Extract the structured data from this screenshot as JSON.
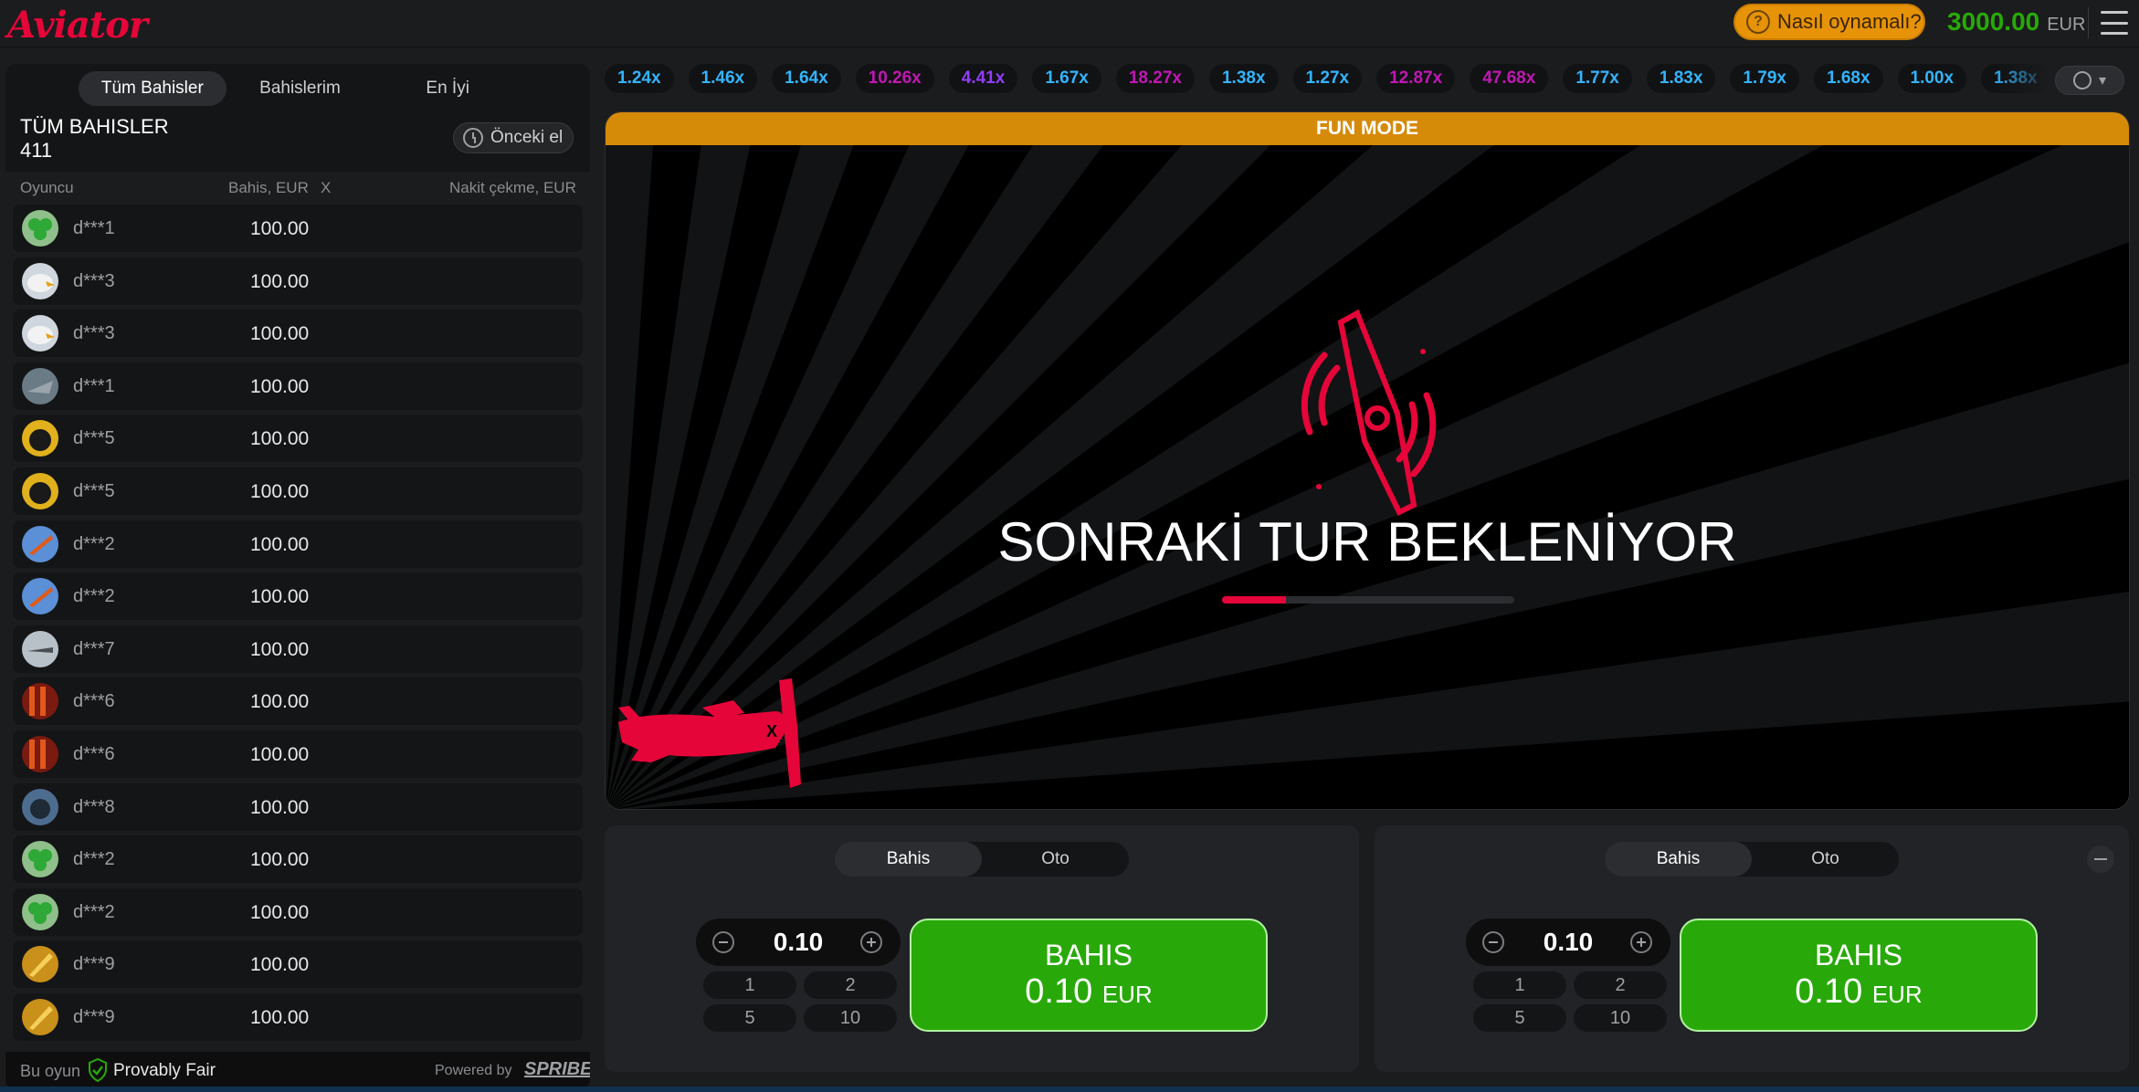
{
  "header": {
    "logo": "Aviator",
    "how_to_play": "Nasıl oynamalı?",
    "balance_amount": "3000.00",
    "balance_currency": "EUR"
  },
  "bets_panel": {
    "tabs": [
      "Tüm Bahisler",
      "Bahislerim",
      "En İyi"
    ],
    "active_tab": 0,
    "title": "TÜM BAHISLER",
    "count": "411",
    "previous_round": "Önceki el",
    "columns": {
      "player": "Oyuncu",
      "bet": "Bahis, EUR",
      "x": "X",
      "cashout": "Nakit çekme, EUR"
    },
    "rows": [
      {
        "player": "d***1",
        "bet": "100.00",
        "avatar": "clover"
      },
      {
        "player": "d***3",
        "bet": "100.00",
        "avatar": "eagle"
      },
      {
        "player": "d***3",
        "bet": "100.00",
        "avatar": "eagle"
      },
      {
        "player": "d***1",
        "bet": "100.00",
        "avatar": "jet"
      },
      {
        "player": "d***5",
        "bet": "100.00",
        "avatar": "panther"
      },
      {
        "player": "d***5",
        "bet": "100.00",
        "avatar": "panther"
      },
      {
        "player": "d***2",
        "bet": "100.00",
        "avatar": "plane-blue"
      },
      {
        "player": "d***2",
        "bet": "100.00",
        "avatar": "plane-blue"
      },
      {
        "player": "d***7",
        "bet": "100.00",
        "avatar": "fighter"
      },
      {
        "player": "d***6",
        "bet": "100.00",
        "avatar": "flames"
      },
      {
        "player": "d***6",
        "bet": "100.00",
        "avatar": "flames"
      },
      {
        "player": "d***8",
        "bet": "100.00",
        "avatar": "gorilla"
      },
      {
        "player": "d***2",
        "bet": "100.00",
        "avatar": "clover"
      },
      {
        "player": "d***2",
        "bet": "100.00",
        "avatar": "clover"
      },
      {
        "player": "d***9",
        "bet": "100.00",
        "avatar": "gold"
      },
      {
        "player": "d***9",
        "bet": "100.00",
        "avatar": "gold"
      }
    ],
    "footer": {
      "this_game": "Bu oyun",
      "provably_fair": "Provably Fair",
      "powered_by": "Powered by",
      "brand": "SPRIBE"
    }
  },
  "multipliers": [
    {
      "value": "1.24x",
      "color": "#34b4ff"
    },
    {
      "value": "1.46x",
      "color": "#34b4ff"
    },
    {
      "value": "1.64x",
      "color": "#34b4ff"
    },
    {
      "value": "10.26x",
      "color": "#c017b4"
    },
    {
      "value": "4.41x",
      "color": "#913ef8"
    },
    {
      "value": "1.67x",
      "color": "#34b4ff"
    },
    {
      "value": "18.27x",
      "color": "#c017b4"
    },
    {
      "value": "1.38x",
      "color": "#34b4ff"
    },
    {
      "value": "1.27x",
      "color": "#34b4ff"
    },
    {
      "value": "12.87x",
      "color": "#c017b4"
    },
    {
      "value": "47.68x",
      "color": "#c017b4"
    },
    {
      "value": "1.77x",
      "color": "#34b4ff"
    },
    {
      "value": "1.83x",
      "color": "#34b4ff"
    },
    {
      "value": "1.79x",
      "color": "#34b4ff"
    },
    {
      "value": "1.68x",
      "color": "#34b4ff"
    },
    {
      "value": "1.00x",
      "color": "#34b4ff"
    },
    {
      "value": "1.38x",
      "color": "#34b4ff"
    }
  ],
  "game": {
    "mode_banner": "FUN MODE",
    "status": "SONRAKİ TUR BEKLENİYOR",
    "progress": 0.22,
    "accent": "#e50539"
  },
  "bet_panels": [
    {
      "tabs": [
        "Bahis",
        "Oto"
      ],
      "amount": "0.10",
      "quick": [
        "1",
        "2",
        "5",
        "10"
      ],
      "button_label": "BAHIS",
      "button_amount": "0.10",
      "button_currency": "EUR"
    },
    {
      "tabs": [
        "Bahis",
        "Oto"
      ],
      "amount": "0.10",
      "quick": [
        "1",
        "2",
        "5",
        "10"
      ],
      "button_label": "BAHIS",
      "button_amount": "0.10",
      "button_currency": "EUR"
    }
  ]
}
